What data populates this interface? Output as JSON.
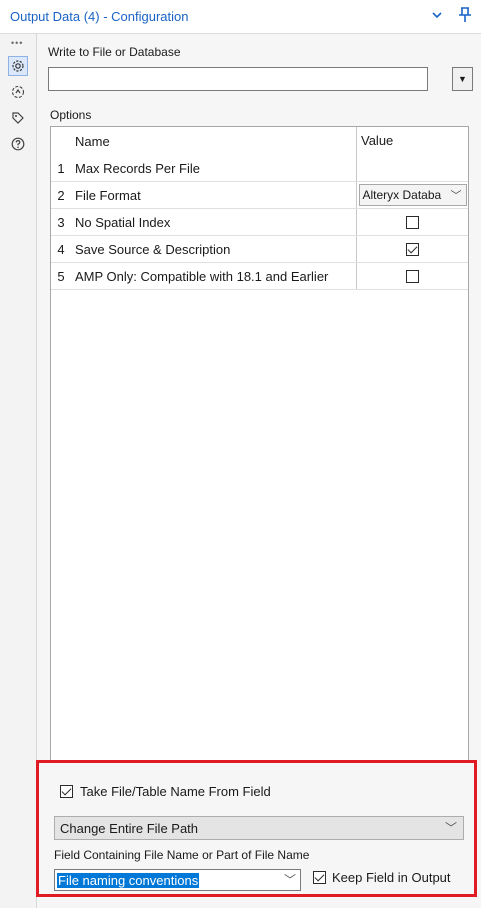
{
  "window": {
    "title": "Output Data (4) - Configuration"
  },
  "leftbar": {
    "icons": [
      "settings-gear-icon",
      "connections-icon",
      "tag-icon",
      "help-icon"
    ]
  },
  "write_section": {
    "label": "Write to File or Database",
    "value": ""
  },
  "options": {
    "label": "Options",
    "headers": {
      "name": "Name",
      "value": "Value"
    },
    "rows": [
      {
        "num": "1",
        "name": "Max Records Per File",
        "value": ""
      },
      {
        "num": "2",
        "name": "File Format",
        "value": "Alteryx Databa"
      },
      {
        "num": "3",
        "name": "No Spatial Index",
        "checked": false
      },
      {
        "num": "4",
        "name": "Save Source & Description",
        "checked": true
      },
      {
        "num": "5",
        "name": "AMP Only: Compatible with 18.1 and Earlier",
        "checked": false
      }
    ]
  },
  "name_from_field": {
    "checkbox_label": "Take File/Table Name From Field",
    "checked": true,
    "mode": "Change Entire File Path",
    "field_label": "Field Containing File Name or Part of File Name",
    "field_value": "File naming conventions",
    "keep_label": "Keep Field in Output",
    "keep_checked": true
  },
  "colors": {
    "accent": "#1a63c6",
    "highlight_box": "#e01b24",
    "selection": "#0078d7"
  }
}
